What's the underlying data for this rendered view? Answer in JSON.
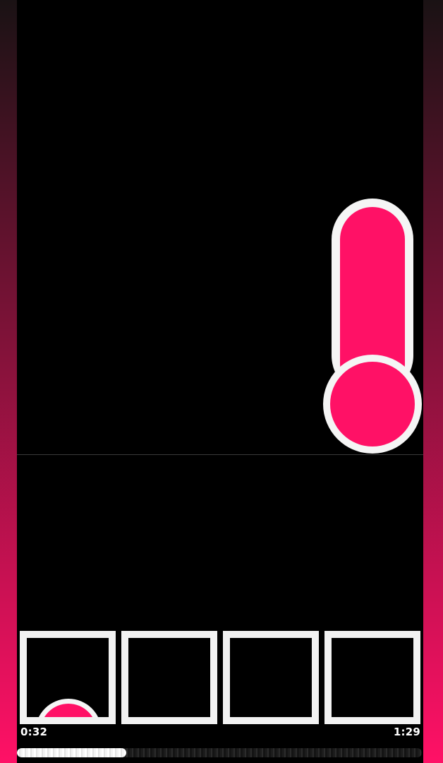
{
  "colors": {
    "accent": "#ff1166",
    "outline": "#f5f5f5",
    "background": "#000000",
    "side_gradient_top": "#1a1214",
    "side_gradient_bottom": "#ff1166"
  },
  "playfield": {
    "active_piece": {
      "shape": "thermometer-piece",
      "color": "#ff1166"
    }
  },
  "slots": [
    {
      "content": "partial-piece-arc"
    },
    {
      "content": "empty"
    },
    {
      "content": "empty"
    },
    {
      "content": "empty"
    }
  ],
  "timer": {
    "elapsed": "0:32",
    "total": "1:29",
    "progress_fraction": 0.27
  }
}
